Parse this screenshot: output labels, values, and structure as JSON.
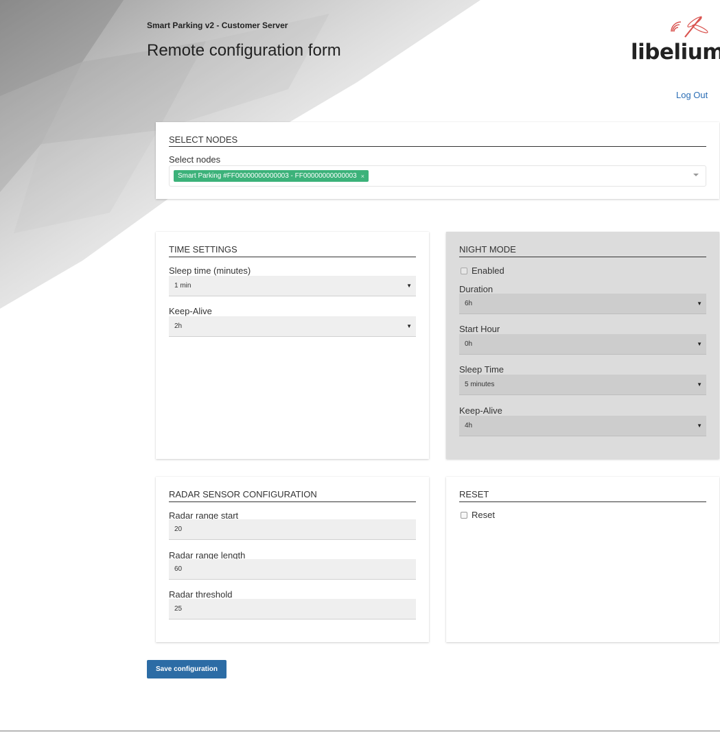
{
  "header": {
    "app_title": "Smart Parking v2 - Customer Server",
    "page_title": "Remote configuration form",
    "logo_text": "libelium",
    "logout_label": "Log Out"
  },
  "select_nodes": {
    "heading": "SELECT NODES",
    "label": "Select nodes",
    "selected_chip": "Smart Parking #FF00000000000003 - FF00000000000003",
    "chip_remove": "×"
  },
  "time_settings": {
    "heading": "TIME SETTINGS",
    "sleep_label": "Sleep time (minutes)",
    "sleep_value": "1 min",
    "keepalive_label": "Keep-Alive",
    "keepalive_value": "2h"
  },
  "night_mode": {
    "heading": "NIGHT MODE",
    "enabled_label": "Enabled",
    "enabled_checked": false,
    "duration_label": "Duration",
    "duration_value": "6h",
    "start_label": "Start Hour",
    "start_value": "0h",
    "sleep_label": "Sleep Time",
    "sleep_value": "5 minutes",
    "keepalive_label": "Keep-Alive",
    "keepalive_value": "4h"
  },
  "radar": {
    "heading": "RADAR SENSOR CONFIGURATION",
    "start_label": "Radar range start",
    "start_value": "20",
    "length_label": "Radar range length",
    "length_value": "60",
    "threshold_label": "Radar threshold",
    "threshold_value": "25"
  },
  "reset": {
    "heading": "RESET",
    "reset_label": "Reset",
    "reset_checked": false
  },
  "actions": {
    "save_label": "Save configuration"
  },
  "colors": {
    "accent": "#2c6ca5",
    "chip": "#3cb27a",
    "link": "#2a6db5",
    "logo_red": "#d9534f"
  }
}
